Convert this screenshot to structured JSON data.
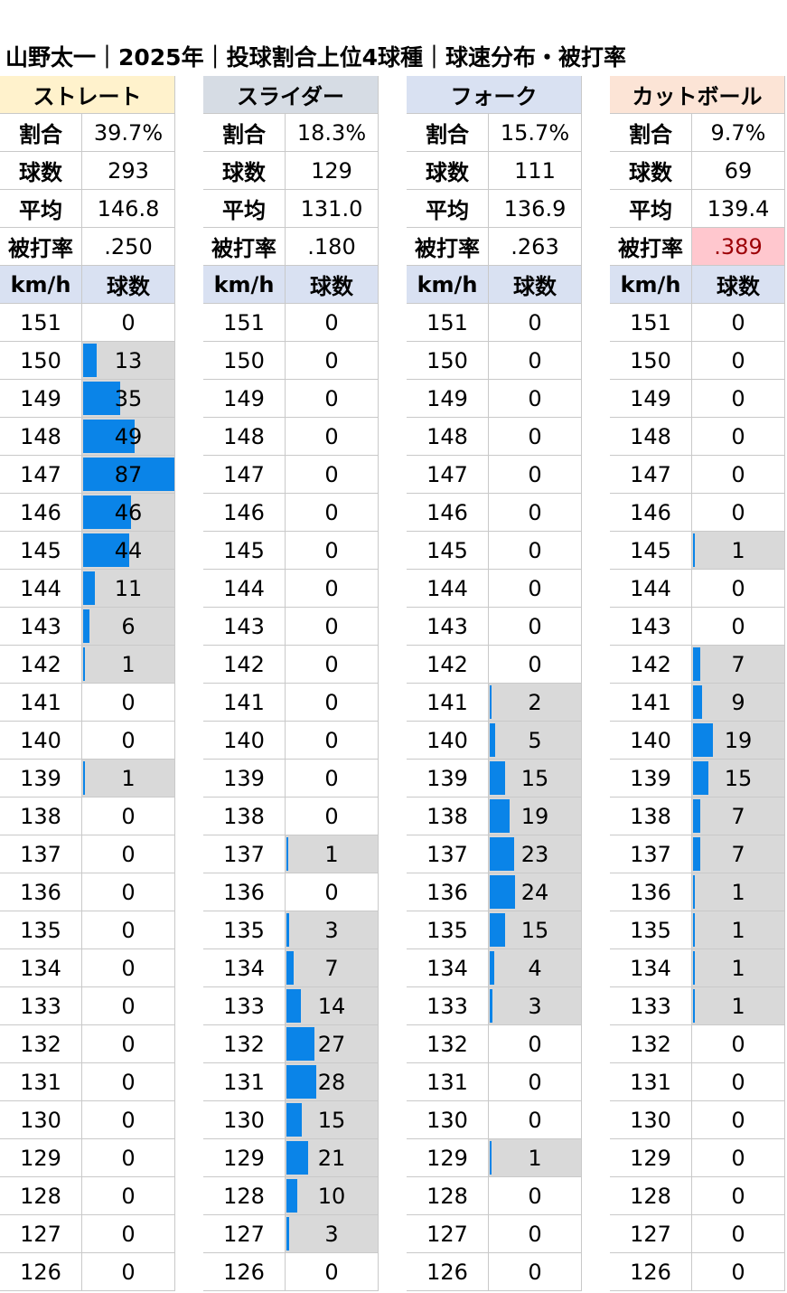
{
  "title": "山野太一｜2025年｜投球割合上位4球種｜球速分布・被打率",
  "labels": {
    "ratio": "割合",
    "count": "球数",
    "avg": "平均",
    "bavg": "被打率",
    "kmh": "km/h",
    "pitches": "球数"
  },
  "colors": {
    "bar": "#0a84e8",
    "count_bg": "#d9d9d9",
    "highlight_bg": "#ffc7ce",
    "highlight_text": "#9c0006"
  },
  "chart_data": {
    "type": "table",
    "speeds": [
      151,
      150,
      149,
      148,
      147,
      146,
      145,
      144,
      143,
      142,
      141,
      140,
      139,
      138,
      137,
      136,
      135,
      134,
      133,
      132,
      131,
      130,
      129,
      128,
      127,
      126
    ],
    "pitch_types": [
      {
        "name": "ストレート",
        "header_color": "#fff2cc",
        "ratio": "39.7%",
        "count": "293",
        "avg": "146.8",
        "bavg": "0.250",
        "bavg_display": ".250",
        "bavg_highlight": false,
        "counts": [
          0,
          13,
          35,
          49,
          87,
          46,
          44,
          11,
          6,
          1,
          0,
          0,
          1,
          0,
          0,
          0,
          0,
          0,
          0,
          0,
          0,
          0,
          0,
          0,
          0,
          0
        ]
      },
      {
        "name": "スライダー",
        "header_color": "#d6dce4",
        "ratio": "18.3%",
        "count": "129",
        "avg": "131.0",
        "bavg": "0.180",
        "bavg_display": ".180",
        "bavg_highlight": false,
        "counts": [
          0,
          0,
          0,
          0,
          0,
          0,
          0,
          0,
          0,
          0,
          0,
          0,
          0,
          0,
          1,
          0,
          3,
          7,
          14,
          27,
          28,
          15,
          21,
          10,
          3,
          0
        ]
      },
      {
        "name": "フォーク",
        "header_color": "#d9e1f2",
        "ratio": "15.7%",
        "count": "111",
        "avg": "136.9",
        "bavg": "0.263",
        "bavg_display": ".263",
        "bavg_highlight": false,
        "counts": [
          0,
          0,
          0,
          0,
          0,
          0,
          0,
          0,
          0,
          0,
          2,
          5,
          15,
          19,
          23,
          24,
          15,
          4,
          3,
          0,
          0,
          0,
          1,
          0,
          0,
          0
        ]
      },
      {
        "name": "カットボール",
        "header_color": "#fce4d6",
        "ratio": "9.7%",
        "count": "69",
        "avg": "139.4",
        "bavg": "0.389",
        "bavg_display": ".389",
        "bavg_highlight": true,
        "counts": [
          0,
          0,
          0,
          0,
          0,
          0,
          1,
          0,
          0,
          7,
          9,
          19,
          15,
          7,
          7,
          1,
          1,
          1,
          1,
          0,
          0,
          0,
          0,
          0,
          0,
          0
        ]
      }
    ],
    "bar_max": 87
  }
}
